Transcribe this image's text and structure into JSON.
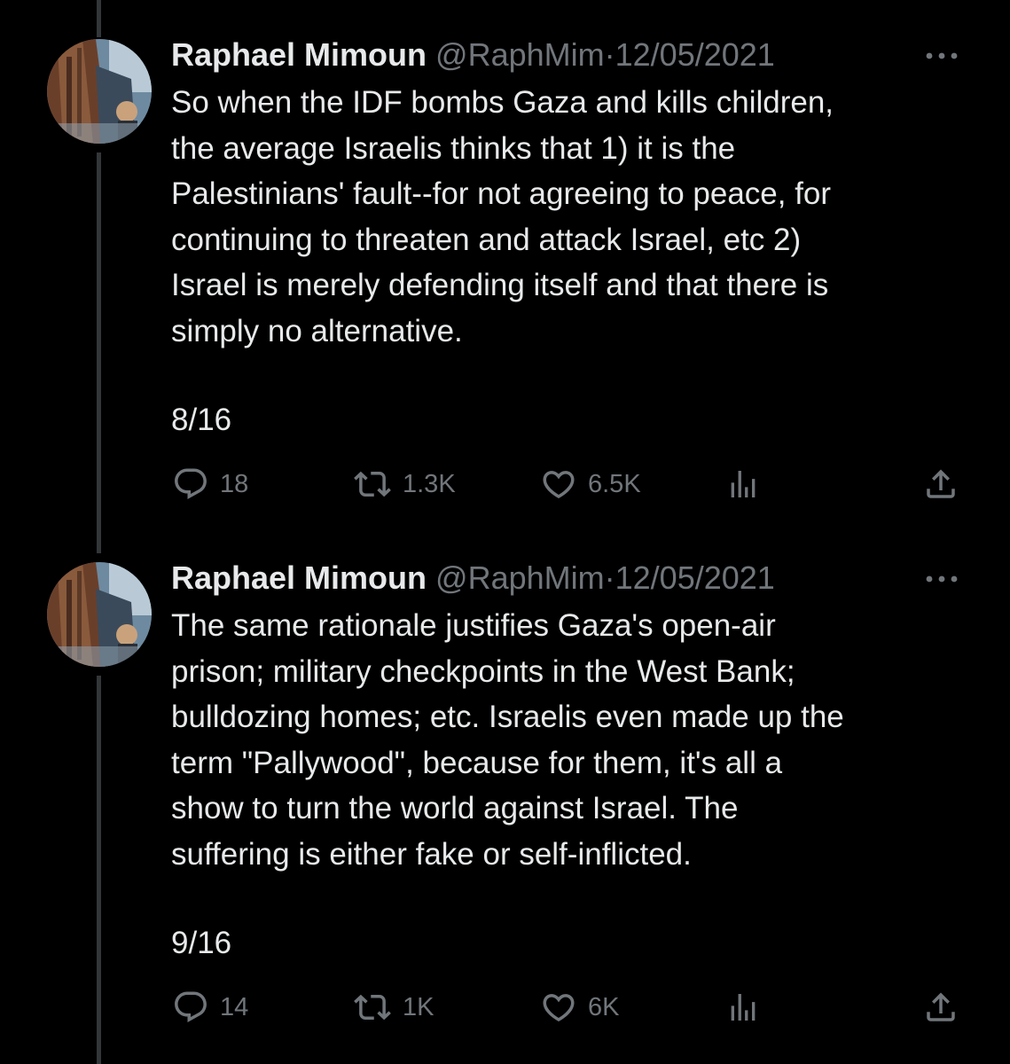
{
  "tweets": [
    {
      "display_name": "Raphael Mimoun",
      "handle": "@RaphMim",
      "separator": "·",
      "date": "12/05/2021",
      "text": "So when the IDF bombs Gaza and kills children,\nthe average Israelis thinks that 1) it is the\nPalestinians' fault--for not agreeing to peace, for\ncontinuing to threaten and attack Israel, etc 2)\nIsrael is merely defending itself and that there is\nsimply no alternative.",
      "thread_count": "8/16",
      "replies": "18",
      "retweets": "1.3K",
      "likes": "6.5K"
    },
    {
      "display_name": "Raphael Mimoun",
      "handle": "@RaphMim",
      "separator": "·",
      "date": "12/05/2021",
      "text": "The same rationale justifies Gaza's open-air\nprison; military checkpoints in the West Bank;\nbulldozing homes; etc. Israelis even made up the\nterm \"Pallywood\", because for them, it's all a\nshow to turn the world against Israel. The\nsuffering is either fake or self-inflicted.",
      "thread_count": "9/16",
      "replies": "14",
      "retweets": "1K",
      "likes": "6K"
    }
  ],
  "icons": {
    "reply": "reply-icon",
    "retweet": "retweet-icon",
    "like": "heart-icon",
    "views": "analytics-icon",
    "share": "share-icon",
    "more": "more-icon"
  },
  "colors": {
    "background": "#000000",
    "text": "#e7e9ea",
    "secondary": "#71767b",
    "thread_line": "#333639"
  }
}
